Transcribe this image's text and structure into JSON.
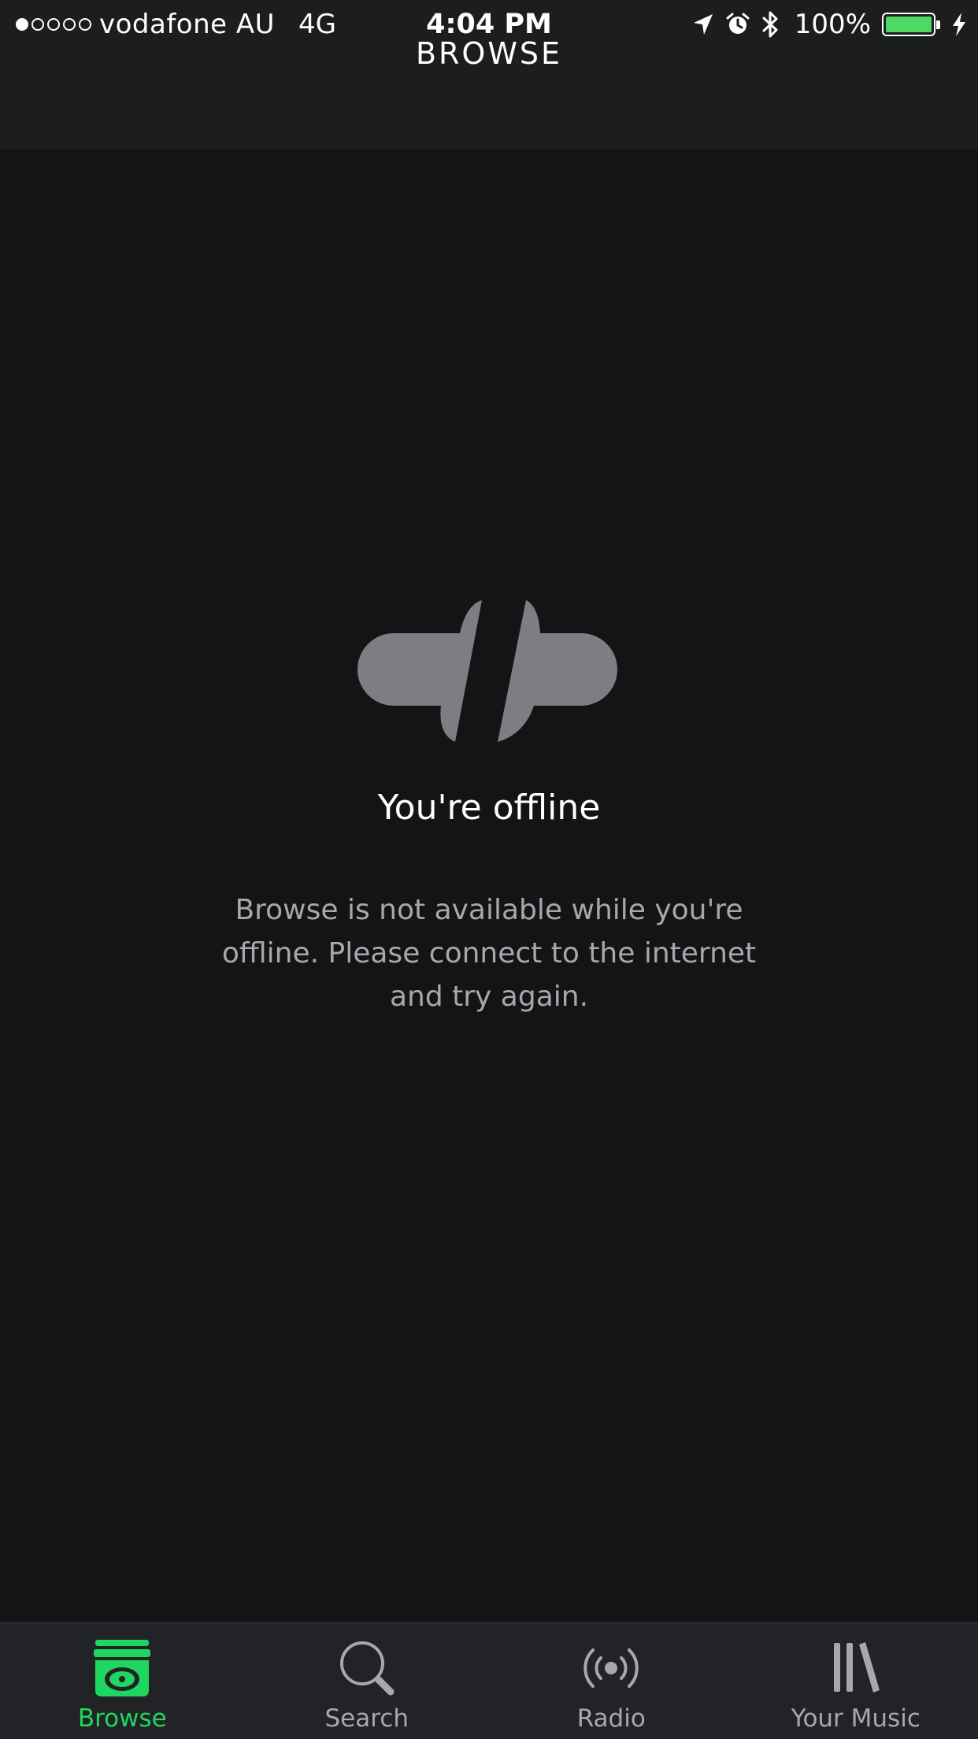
{
  "status_bar": {
    "carrier": "vodafone AU",
    "network": "4G",
    "time": "4:04 PM",
    "battery_percent": "100%",
    "battery_level": 1.0,
    "signal_bars_filled": 1,
    "signal_bars_total": 5,
    "icons": [
      "location-arrow-icon",
      "alarm-icon",
      "bluetooth-icon",
      "battery-icon",
      "charging-bolt-icon"
    ]
  },
  "nav": {
    "title": "BROWSE"
  },
  "offline": {
    "icon": "disconnected-icon",
    "title": "You're offline",
    "message": "Browse is not available while you're offline. Please connect to the internet and try again."
  },
  "tabs": [
    {
      "label": "Browse",
      "icon": "browse-icon",
      "active": true
    },
    {
      "label": "Search",
      "icon": "search-icon",
      "active": false
    },
    {
      "label": "Radio",
      "icon": "radio-icon",
      "active": false
    },
    {
      "label": "Your Music",
      "icon": "library-icon",
      "active": false
    }
  ],
  "colors": {
    "background": "#131416",
    "bar_background": "#1c1d1f",
    "tab_bar_background": "#222326",
    "accent_green": "#1ed760",
    "muted_text": "#a7a8ab",
    "icon_gray": "#7d7e82",
    "battery_green": "#4cd964"
  }
}
